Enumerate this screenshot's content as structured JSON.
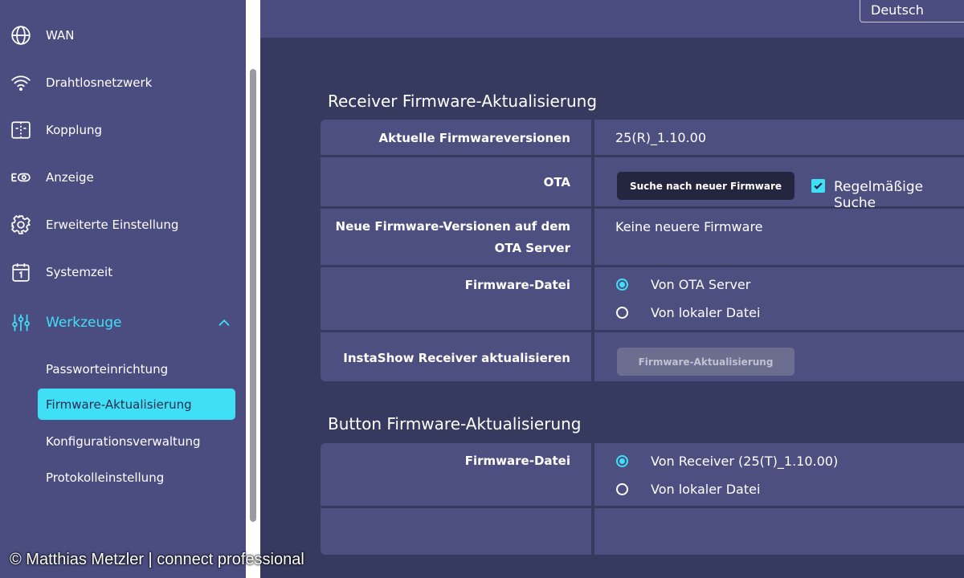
{
  "sidebar": {
    "items": [
      {
        "label": "WAN",
        "icon": "globe-icon"
      },
      {
        "label": "Drahtlosnetzwerk",
        "icon": "wifi-icon"
      },
      {
        "label": "Kopplung",
        "icon": "pairing-icon"
      },
      {
        "label": "Anzeige",
        "icon": "display-icon"
      },
      {
        "label": "Erweiterte Einstellung",
        "icon": "gear-icon"
      },
      {
        "label": "Systemzeit",
        "icon": "calendar-icon"
      },
      {
        "label": "Werkzeuge",
        "icon": "sliders-icon",
        "expanded": true
      }
    ],
    "subitems": [
      {
        "label": "Passworteinrichtung"
      },
      {
        "label": "Firmware-Aktualisierung",
        "selected": true
      },
      {
        "label": "Konfigurationsverwaltung"
      },
      {
        "label": "Protokolleinstellung"
      }
    ]
  },
  "header": {
    "language": "Deutsch"
  },
  "receiver": {
    "title": "Receiver Firmware-Aktualisierung",
    "current_label": "Aktuelle Firmwareversionen",
    "current_value": "25(R)_1.10.00",
    "ota_label": "OTA",
    "search_button": "Suche nach neuer Firmware",
    "regular_search_label": "Regelmäßige Suche",
    "regular_search_checked": true,
    "new_versions_label_line1": "Neue Firmware-Versionen auf dem",
    "new_versions_label_line2": "OTA Server",
    "new_versions_value": "Keine neuere Firmware",
    "file_label": "Firmware-Datei",
    "file_option_ota": "Von OTA Server",
    "file_option_local": "Von lokaler Datei",
    "file_selected": "ota",
    "update_label": "InstaShow Receiver aktualisieren",
    "update_button": "Firmware-Aktualisierung"
  },
  "button_fw": {
    "title": "Button Firmware-Aktualisierung",
    "file_label": "Firmware-Datei",
    "file_option_receiver": "Von Receiver (25(T)_1.10.00)",
    "file_option_local": "Von lokaler Datei",
    "file_selected": "receiver"
  },
  "watermark": "© Matthias Metzler | connect professional",
  "colors": {
    "accent": "#3fe0f5",
    "sidebar": "#4b4d80",
    "background": "#363a5e",
    "cell": "#4d4f80"
  }
}
